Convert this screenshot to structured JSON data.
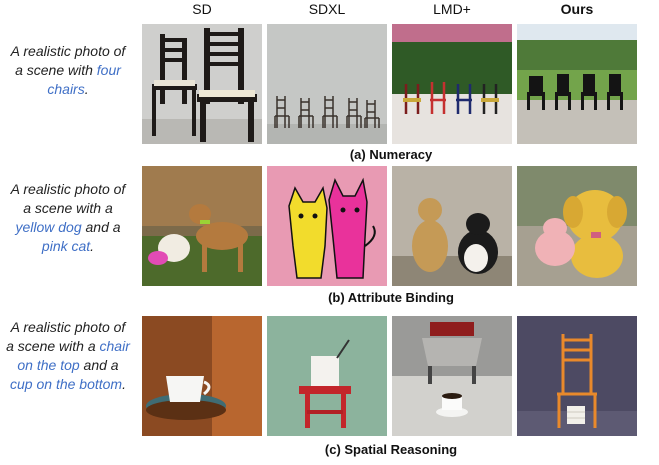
{
  "columns": [
    "SD",
    "SDXL",
    "LMD+",
    "Ours"
  ],
  "rows": [
    {
      "prompt_parts": [
        {
          "text": "A realistic photo of a scene with ",
          "highlight": false
        },
        {
          "text": "four chairs",
          "highlight": true
        },
        {
          "text": ".",
          "highlight": false
        }
      ],
      "caption": "(a) Numeracy"
    },
    {
      "prompt_parts": [
        {
          "text": "A realistic photo of a scene with a ",
          "highlight": false
        },
        {
          "text": "yellow dog",
          "highlight": true
        },
        {
          "text": " and a ",
          "highlight": false
        },
        {
          "text": "pink cat",
          "highlight": true
        },
        {
          "text": ".",
          "highlight": false
        }
      ],
      "caption": "(b) Attribute Binding"
    },
    {
      "prompt_parts": [
        {
          "text": "A realistic photo of a scene with a ",
          "highlight": false
        },
        {
          "text": "chair on the top",
          "highlight": true
        },
        {
          "text": " and a ",
          "highlight": false
        },
        {
          "text": "cup on the bottom",
          "highlight": true
        },
        {
          "text": ".",
          "highlight": false
        }
      ],
      "caption": "(c) Spatial Reasoning"
    }
  ],
  "colors": {
    "highlight": "#3f6fc6"
  },
  "images": [
    [
      "black-chairs-closeup-photo",
      "empty-room-chairs-photo",
      "colored-chairs-hedge-photo",
      "four-chairs-lawn-photo"
    ],
    [
      "dog-and-small-dog-photo",
      "yellow-and-pink-cartoon-cats",
      "dog-and-cat-sitting-photo",
      "yellow-dog-pink-cat-photo"
    ],
    [
      "cup-on-wooden-chair-photo",
      "cup-on-red-stool-photo",
      "cup-below-chair-photo",
      "cup-under-orange-chair-photo"
    ]
  ]
}
